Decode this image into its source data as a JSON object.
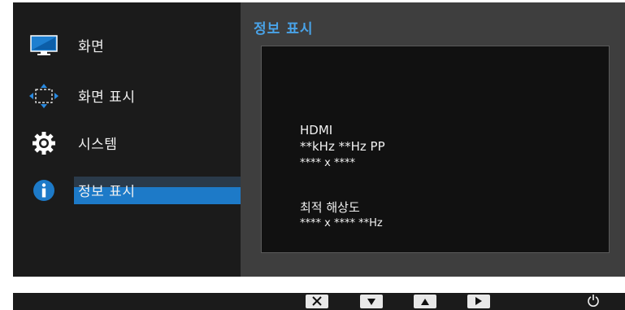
{
  "sidebar": {
    "items": [
      {
        "label": "화면",
        "icon": "monitor-icon"
      },
      {
        "label": "화면 표시",
        "icon": "move-arrows-icon"
      },
      {
        "label": "시스템",
        "icon": "gear-icon"
      },
      {
        "label": "정보 표시",
        "icon": "info-icon",
        "selected": true
      }
    ]
  },
  "panel": {
    "title": "정보 표시",
    "lines": [
      "HDMI",
      "**kHz **Hz PP",
      "**** x ****",
      "최적 해상도",
      "**** x **** **Hz"
    ]
  },
  "bottom_bar": {
    "keys": [
      "close-key",
      "down-key",
      "up-key",
      "right-key",
      "power-key"
    ]
  },
  "colors": {
    "title_blue": "#49a3e8",
    "selection_blue": "#1d7ac8",
    "background_dark": "#1b1b1b",
    "panel_gray": "#3e3e3e"
  }
}
